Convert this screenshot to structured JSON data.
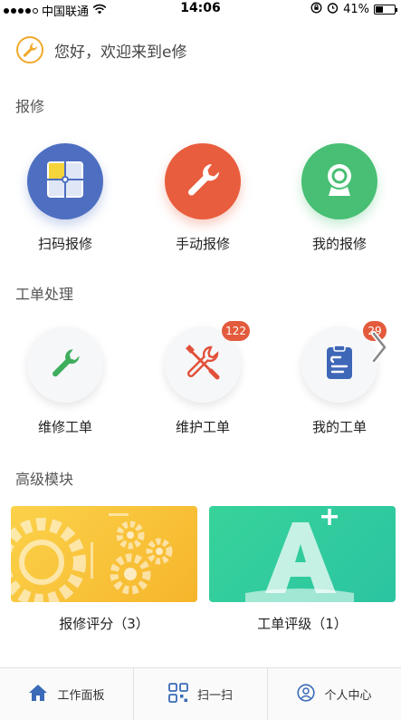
{
  "status_bar": {
    "carrier": "中国联通",
    "time": "14:06",
    "battery": "41%",
    "battery_level": 0.41,
    "wifi_icon": "wifi-icon",
    "lock_icon": "rotation-lock-icon",
    "alarm_icon": "alarm-icon"
  },
  "greeting": {
    "text": "您好，欢迎来到e修",
    "logo_icon": "wrench-logo-icon"
  },
  "sections": {
    "repair": "报修",
    "work_orders": "工单处理",
    "advanced": "高级模块"
  },
  "repair_items": [
    {
      "label": "扫码报修",
      "icon": "qr-scan-icon",
      "color": "#4e6fc1"
    },
    {
      "label": "手动报修",
      "icon": "wrench-icon",
      "color": "#e85d3d"
    },
    {
      "label": "我的报修",
      "icon": "camera-icon",
      "color": "#48bf74"
    }
  ],
  "work_order_items": [
    {
      "label": "维修工单",
      "icon": "wrench-icon",
      "badge": ""
    },
    {
      "label": "维护工单",
      "icon": "tools-icon",
      "badge": "122"
    },
    {
      "label": "我的工单",
      "icon": "clipboard-icon",
      "badge": "29"
    }
  ],
  "advanced_cards": [
    {
      "label": "报修评分（3）",
      "icon": "gears-icon",
      "color": "#f9c43c"
    },
    {
      "label": "工单评级（1）",
      "icon": "grade-a-plus-icon",
      "color": "#33cc9e"
    }
  ],
  "tab_bar": [
    {
      "label": "工作面板",
      "icon": "home-icon"
    },
    {
      "label": "扫一扫",
      "icon": "scan-icon"
    },
    {
      "label": "个人中心",
      "icon": "user-icon"
    }
  ]
}
